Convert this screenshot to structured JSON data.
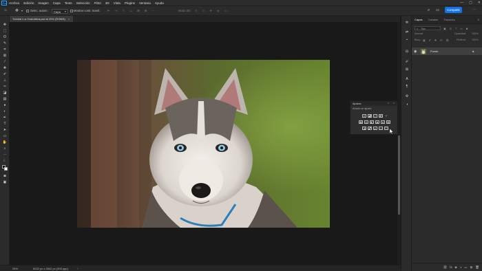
{
  "menubar": {
    "logo": "Ps",
    "items": [
      "Archivo",
      "Edición",
      "Imagen",
      "Capa",
      "Texto",
      "Selección",
      "Filtro",
      "3D",
      "Vista",
      "Plugins",
      "Ventana",
      "Ayuda"
    ],
    "window_controls": [
      "—",
      "▢",
      "✕"
    ]
  },
  "options": {
    "auto_select_label": "Selec. autom.:",
    "auto_select_value": "Capa",
    "transform_label": "Mostrar contr. transf.",
    "mode_3d_label": "Modo 3D:",
    "share_label": "Compartir"
  },
  "document": {
    "tab_title": "Tutorial Luz Dramática.psd al 25% (RGB/8)",
    "tab_close": "×"
  },
  "status": {
    "zoom": "25%",
    "info": "6022 px x 2842 px (300 ppp)",
    "arrow": "›"
  },
  "adjustments": {
    "title": "Ajustes",
    "subtitle": "Añadir un ajuste",
    "row1_icons": [
      "brightness-icon",
      "levels-icon",
      "curves-icon",
      "exposure-icon",
      "vibrance-icon"
    ],
    "row2_icons": [
      "hue-icon",
      "color-balance-icon",
      "black-white-icon",
      "photo-filter-icon",
      "channel-mixer-icon",
      "color-lookup-icon"
    ],
    "row3_icons": [
      "invert-icon",
      "posterize-icon",
      "threshold-icon",
      "gradient-map-icon",
      "selective-color-icon"
    ]
  },
  "layers_panel": {
    "tabs": [
      "Capas",
      "Canales",
      "Trazados"
    ],
    "search_placeholder": "Tipo",
    "blend_mode": "Normal",
    "opacity_label": "Opacidad:",
    "opacity_value": "100%",
    "lock_label": "Bloq.:",
    "fill_label": "Relleno:",
    "fill_value": "100%",
    "layer_name": "Fondo"
  },
  "colors": {
    "accent": "#1473e6",
    "panel_bg": "#2b2b2b",
    "canvas_bg": "#191919"
  }
}
